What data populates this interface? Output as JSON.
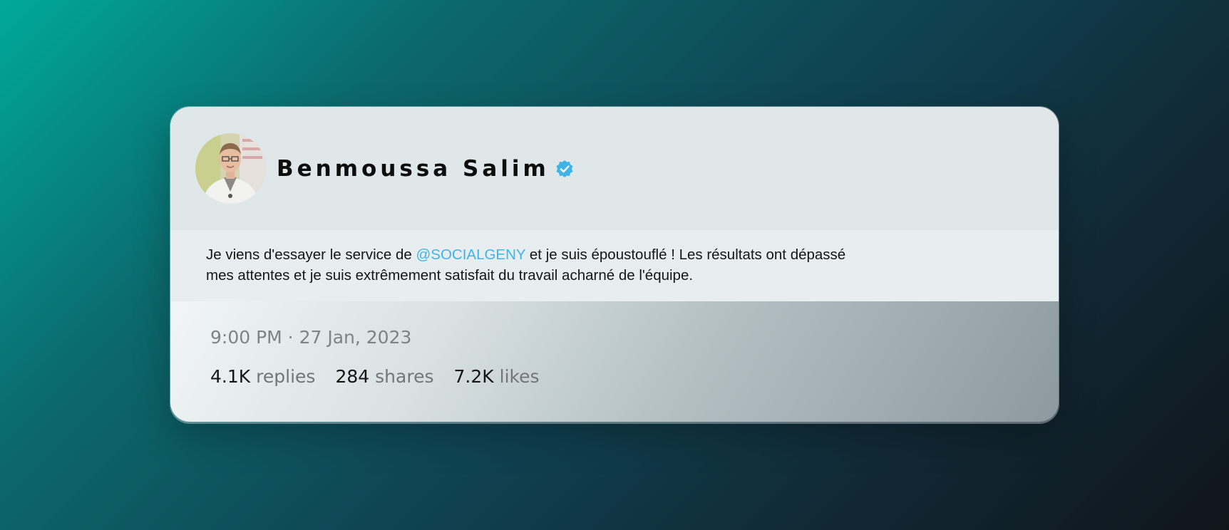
{
  "author": {
    "name": "Benmoussa Salim",
    "verified_icon": "verified-badge-icon",
    "avatar_icon": "avatar-photo"
  },
  "post": {
    "text_before_mention": "Je viens d'essayer le service de ",
    "mention": "@SOCIALGENY",
    "text_after_mention": " et je suis époustouflé ! Les résultats ont dépassé mes attentes et je suis extrêmement satisfait du travail acharné de l'équipe."
  },
  "footer": {
    "timestamp": "9:00 PM · 27 Jan, 2023",
    "stats": [
      {
        "count": "4.1K",
        "label": "replies"
      },
      {
        "count": "284",
        "label": "shares"
      },
      {
        "count": "7.2K",
        "label": "likes"
      }
    ]
  },
  "colors": {
    "mention": "#3eb4e8",
    "verified": "#3eb4e8"
  }
}
